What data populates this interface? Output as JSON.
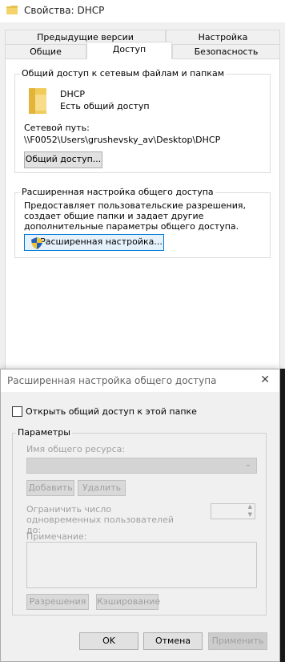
{
  "properties": {
    "title": "Свойства: DHCP",
    "tabs_top": [
      "Предыдущие версии",
      "Настройка"
    ],
    "tabs_bottom": [
      "Общие",
      "Доступ",
      "Безопасность"
    ],
    "share_group": {
      "legend": "Общий доступ к сетевым файлам и папкам",
      "folder_name": "DHCP",
      "status": "Есть общий доступ",
      "path_label": "Сетевой путь:",
      "path_value": "\\\\F0052\\Users\\grushevsky_av\\Desktop\\DHCP",
      "share_button": "Общий доступ..."
    },
    "advanced_group": {
      "legend": "Расширенная настройка общего доступа",
      "description": "Предоставляет пользовательские разрешения, создает общие папки и задает другие дополнительные параметры общего доступа.",
      "button": "Расширенная настройка..."
    }
  },
  "advanced_dialog": {
    "title": "Расширенная настройка общего доступа",
    "share_checkbox_label": "Открыть общий доступ к этой папке",
    "share_checked": false,
    "params_legend": "Параметры",
    "share_name_label": "Имя общего ресурса:",
    "add_button": "Добавить",
    "remove_button": "Удалить",
    "limit_label": "Ограничить число одновременных пользователей до:",
    "comment_label": "Примечание:",
    "permissions_button": "Разрешения",
    "caching_button": "Кэширование",
    "ok_button": "OK",
    "cancel_button": "Отмена",
    "apply_button": "Применить"
  },
  "colors": {
    "accent": "#0078d7",
    "folder": "#e8c14e",
    "disabled_text": "#a0a0a0"
  }
}
